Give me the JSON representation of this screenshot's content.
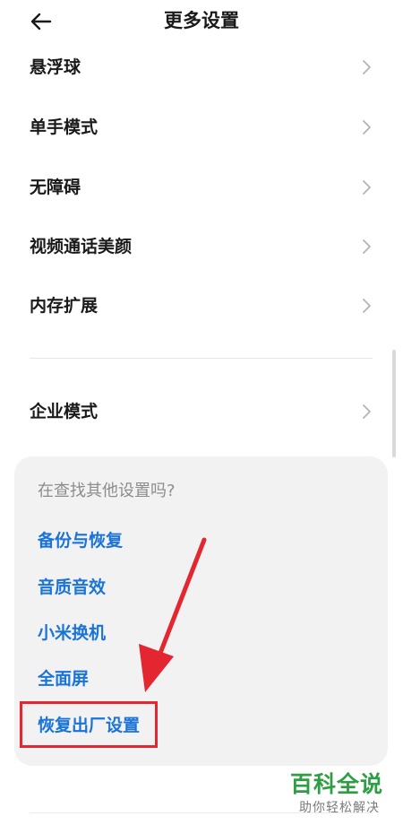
{
  "header": {
    "title": "更多设置",
    "back_icon": "back-arrow-icon"
  },
  "settings": {
    "items": [
      {
        "label": "悬浮球"
      },
      {
        "label": "单手模式"
      },
      {
        "label": "无障碍"
      },
      {
        "label": "视频通话美颜"
      },
      {
        "label": "内存扩展"
      },
      {
        "label": "企业模式"
      }
    ],
    "chevron_icon": "chevron-right-icon"
  },
  "suggestions": {
    "question": "在查找其他设置吗?",
    "links": [
      {
        "label": "备份与恢复"
      },
      {
        "label": "音质音效"
      },
      {
        "label": "小米换机"
      },
      {
        "label": "全面屏"
      },
      {
        "label": "恢复出厂设置"
      }
    ]
  },
  "annotation": {
    "highlight_color": "#e3262f",
    "arrow_icon": "annotation-arrow-icon"
  },
  "watermark": {
    "main": "百科全说",
    "sub": "助你轻松解决"
  },
  "colors": {
    "link": "#1a73d9",
    "text": "#1a1a1a",
    "hint": "#8c8c8c",
    "card_bg": "#f2f2f2",
    "brand_green": "#2e9e42"
  }
}
